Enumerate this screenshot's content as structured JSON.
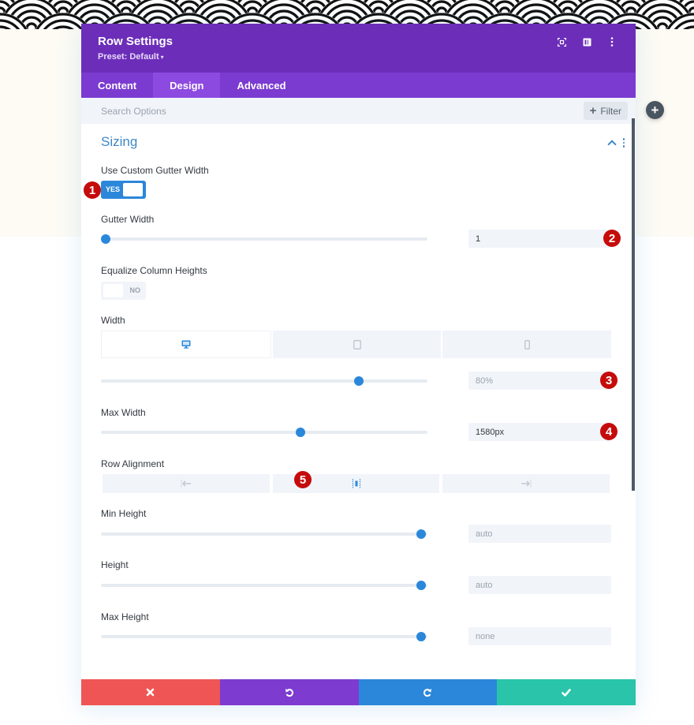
{
  "page": {
    "background_top_color": "#fdfbf4",
    "add_button_icon": "plus-icon"
  },
  "modal": {
    "title": "Row Settings",
    "preset_label": "Preset: Default",
    "preset_caret": "▾",
    "header_icons": [
      "fullscreen-icon",
      "split-view-icon",
      "more-options-icon"
    ],
    "header_color": "#6c2eb9",
    "tabs": [
      {
        "label": "Content",
        "active": false
      },
      {
        "label": "Design",
        "active": true
      },
      {
        "label": "Advanced",
        "active": false
      }
    ],
    "search": {
      "placeholder": "Search Options",
      "value": "",
      "filter_label": "Filter",
      "filter_icon": "plus-icon"
    }
  },
  "section": {
    "title": "Sizing",
    "expanded": true,
    "fields": {
      "custom_gutter": {
        "label": "Use Custom Gutter Width",
        "value": "YES",
        "on": true
      },
      "gutter_width": {
        "label": "Gutter Width",
        "value": "1",
        "slider_fraction": 0.0
      },
      "equalize": {
        "label": "Equalize Column Heights",
        "value": "NO",
        "on": false
      },
      "width": {
        "label": "Width",
        "devices": [
          {
            "name": "desktop",
            "icon": "desktop-icon",
            "active": true
          },
          {
            "name": "tablet",
            "icon": "tablet-icon",
            "active": false
          },
          {
            "name": "phone",
            "icon": "phone-icon",
            "active": false
          }
        ],
        "value": "80%",
        "slider_fraction": 0.79
      },
      "max_width": {
        "label": "Max Width",
        "value": "1580px",
        "slider_fraction": 0.61
      },
      "row_alignment": {
        "label": "Row Alignment",
        "options": [
          {
            "name": "left",
            "icon": "align-left-icon",
            "active": false
          },
          {
            "name": "center",
            "icon": "align-center-icon",
            "active": true
          },
          {
            "name": "right",
            "icon": "align-right-icon",
            "active": false
          }
        ]
      },
      "min_height": {
        "label": "Min Height",
        "value": "auto",
        "slider_fraction": 0.98
      },
      "height": {
        "label": "Height",
        "value": "auto",
        "slider_fraction": 0.98
      },
      "max_height": {
        "label": "Max Height",
        "value": "none",
        "slider_fraction": 0.98
      }
    }
  },
  "annotations": [
    "1",
    "2",
    "3",
    "4",
    "5"
  ],
  "footer": {
    "buttons": [
      {
        "name": "cancel",
        "icon": "close-icon",
        "color": "#ef5555"
      },
      {
        "name": "undo",
        "icon": "undo-icon",
        "color": "#7e3bd0"
      },
      {
        "name": "redo",
        "icon": "redo-icon",
        "color": "#2b87da"
      },
      {
        "name": "save",
        "icon": "check-icon",
        "color": "#29c4a9"
      }
    ]
  }
}
